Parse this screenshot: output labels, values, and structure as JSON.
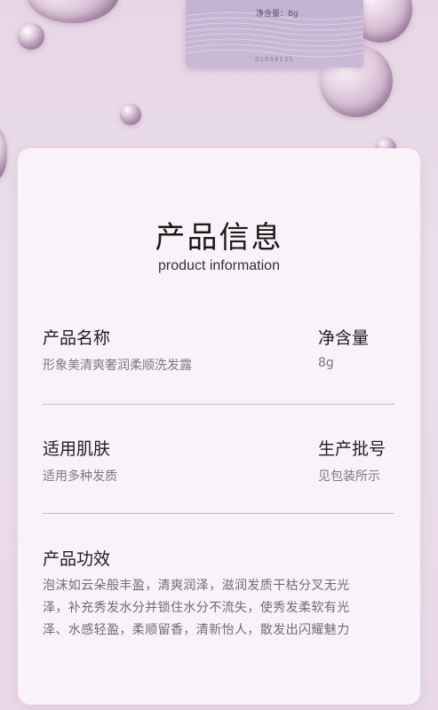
{
  "packet": {
    "net_weight_label": "净含量：8g",
    "code": "0180413S"
  },
  "header": {
    "title": "产品信息",
    "subtitle": "product information"
  },
  "info": {
    "name": {
      "label": "产品名称",
      "value": "形象美清爽奢润柔顺洗发露"
    },
    "net": {
      "label": "净含量",
      "value": "8g"
    },
    "skin": {
      "label": "适用肌肤",
      "value": "适用多种发质"
    },
    "batch": {
      "label": "生产批号",
      "value": "见包装所示"
    }
  },
  "effect": {
    "label": "产品功效",
    "lines": [
      "泡沫如云朵般丰盈，清爽润泽，滋润发质干枯分叉无光",
      "泽，补充秀发水分并锁住水分不流失，使秀发柔软有光",
      "泽、水感轻盈，柔顺留香，清新怡人，散发出闪耀魅力"
    ]
  }
}
